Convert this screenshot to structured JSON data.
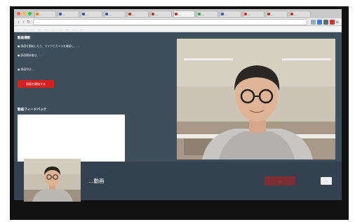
{
  "browser": {
    "tabs": [
      "…",
      "…",
      "…",
      "…",
      "…",
      "…",
      "…",
      "…",
      "…",
      "…",
      "…",
      "…"
    ],
    "address": "…",
    "bookmarks": [
      "…",
      "…",
      "…",
      "…",
      "…",
      "…",
      "…",
      "…",
      "…",
      "…"
    ]
  },
  "page": {
    "section_title": "動画撮影",
    "instructions": [
      "● 録画を開始したら、マイクとカメラを確認し、…",
      "● 録画開始後は、…",
      "● 録画中は…"
    ],
    "record_button": "録画を開始する",
    "feedback_title": "動画フィードバック",
    "feedback_note": "…",
    "bottom_label": "…動画",
    "done_button": "…",
    "small_button": "…"
  },
  "colors": {
    "page_bg": "#3f4e5b",
    "bottom_bar": "#34424f",
    "record_button": "#d91f1f",
    "done_button": "#7b2f35"
  }
}
